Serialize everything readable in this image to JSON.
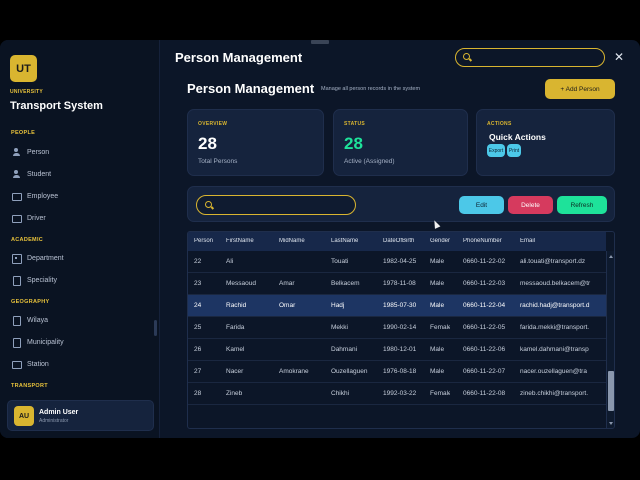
{
  "sidebar": {
    "logo_text": "UT",
    "university_label": "UNIVERSITY",
    "app_title": "Transport System",
    "sections": {
      "people": "PEOPLE",
      "academic": "ACADEMIC",
      "geography": "GEOGRAPHY",
      "transport": "TRANSPORT"
    },
    "items": [
      {
        "label": "Person",
        "icon": "person-icon"
      },
      {
        "label": "Student",
        "icon": "person-icon"
      },
      {
        "label": "Employee",
        "icon": "briefcase-icon"
      },
      {
        "label": "Driver",
        "icon": "id-card-icon"
      },
      {
        "label": "Department",
        "icon": "building-icon"
      },
      {
        "label": "Speciality",
        "icon": "document-icon"
      },
      {
        "label": "Wilaya",
        "icon": "map-icon"
      },
      {
        "label": "Municipality",
        "icon": "map-icon"
      },
      {
        "label": "Station",
        "icon": "station-icon"
      }
    ],
    "user": {
      "avatar": "AU",
      "name": "Admin User",
      "role": "Administrator"
    }
  },
  "header": {
    "window_title": "Person Management",
    "search_placeholder": "",
    "close_symbol": "✕"
  },
  "main": {
    "title": "Person Management",
    "subtitle": "Manage all person records in the system",
    "add_button": "+ Add Person",
    "cards": {
      "overview": {
        "label": "OVERVIEW",
        "value": "28",
        "desc": "Total Persons"
      },
      "status": {
        "label": "STATUS",
        "value": "28",
        "desc": "Active (Assigned)"
      },
      "actions": {
        "label": "ACTIONS",
        "title": "Quick Actions",
        "export": "Export",
        "print": "Print"
      }
    },
    "toolbar": {
      "search_placeholder": "",
      "edit": "Edit",
      "delete": "Delete",
      "refresh": "Refresh"
    },
    "table": {
      "columns": [
        "Person",
        "FirstName",
        "MidName",
        "LastName",
        "DateOfBirth",
        "Gender",
        "PhoneNumber",
        "Email"
      ],
      "rows": [
        [
          "22",
          "Ali",
          "",
          "Touati",
          "1982-04-25",
          "Male",
          "0660-11-22-02",
          "ali.touati@transport.dz"
        ],
        [
          "23",
          "Messaoud",
          "Amar",
          "Belkacem",
          "1978-11-08",
          "Male",
          "0660-11-22-03",
          "messaoud.belkacem@tr"
        ],
        [
          "24",
          "Rachid",
          "Omar",
          "Hadj",
          "1985-07-30",
          "Male",
          "0660-11-22-04",
          "rachid.hadj@transport.d"
        ],
        [
          "25",
          "Farida",
          "",
          "Mekki",
          "1990-02-14",
          "Female",
          "0660-11-22-05",
          "farida.mekki@transport."
        ],
        [
          "26",
          "Kamel",
          "",
          "Dahmani",
          "1980-12-01",
          "Male",
          "0660-11-22-06",
          "kamel.dahmani@transp"
        ],
        [
          "27",
          "Nacer",
          "Amokrane",
          "Ouzellaguen",
          "1976-08-18",
          "Male",
          "0660-11-22-07",
          "nacer.ouzellaguen@tra"
        ],
        [
          "28",
          "Zineb",
          "",
          "Chikhi",
          "1992-03-22",
          "Female",
          "0660-11-22-08",
          "zineb.chikhi@transport."
        ]
      ],
      "selected_index": 2
    }
  },
  "colors": {
    "accent": "#d9b530",
    "cyan": "#4cc8e8",
    "danger": "#d63a5e",
    "success": "#1ee29a",
    "background": "#0c1628"
  }
}
